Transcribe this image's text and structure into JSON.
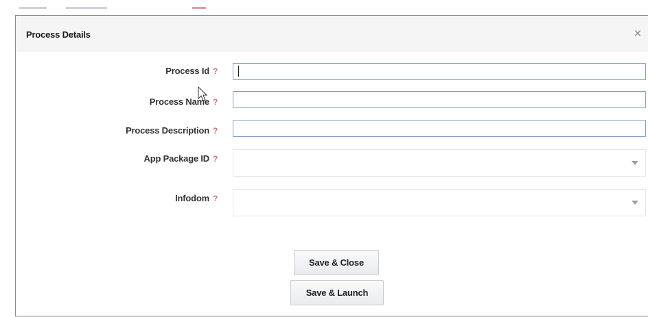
{
  "dialog": {
    "title": "Process Details",
    "close_symbol": "×"
  },
  "form": {
    "fields": [
      {
        "label": "Process Id",
        "help": "?",
        "value": "",
        "placeholder": ""
      },
      {
        "label": "Process Name",
        "help": "?",
        "value": "",
        "placeholder": ""
      },
      {
        "label": "Process Description",
        "help": "?",
        "value": "",
        "placeholder": ""
      },
      {
        "label": "App Package ID",
        "help": "?",
        "selected": ""
      },
      {
        "label": "Infodom",
        "help": "?",
        "selected": ""
      }
    ]
  },
  "actions": {
    "save_close": "Save & Close",
    "save_launch": "Save & Launch"
  },
  "colors": {
    "help": "#d1747d",
    "input_border": "#7f9dc8",
    "header_bg": "#f5f5f5"
  },
  "icons": [
    "close-icon",
    "help-icon",
    "dropdown-arrow-icon",
    "mouse-pointer-icon"
  ]
}
